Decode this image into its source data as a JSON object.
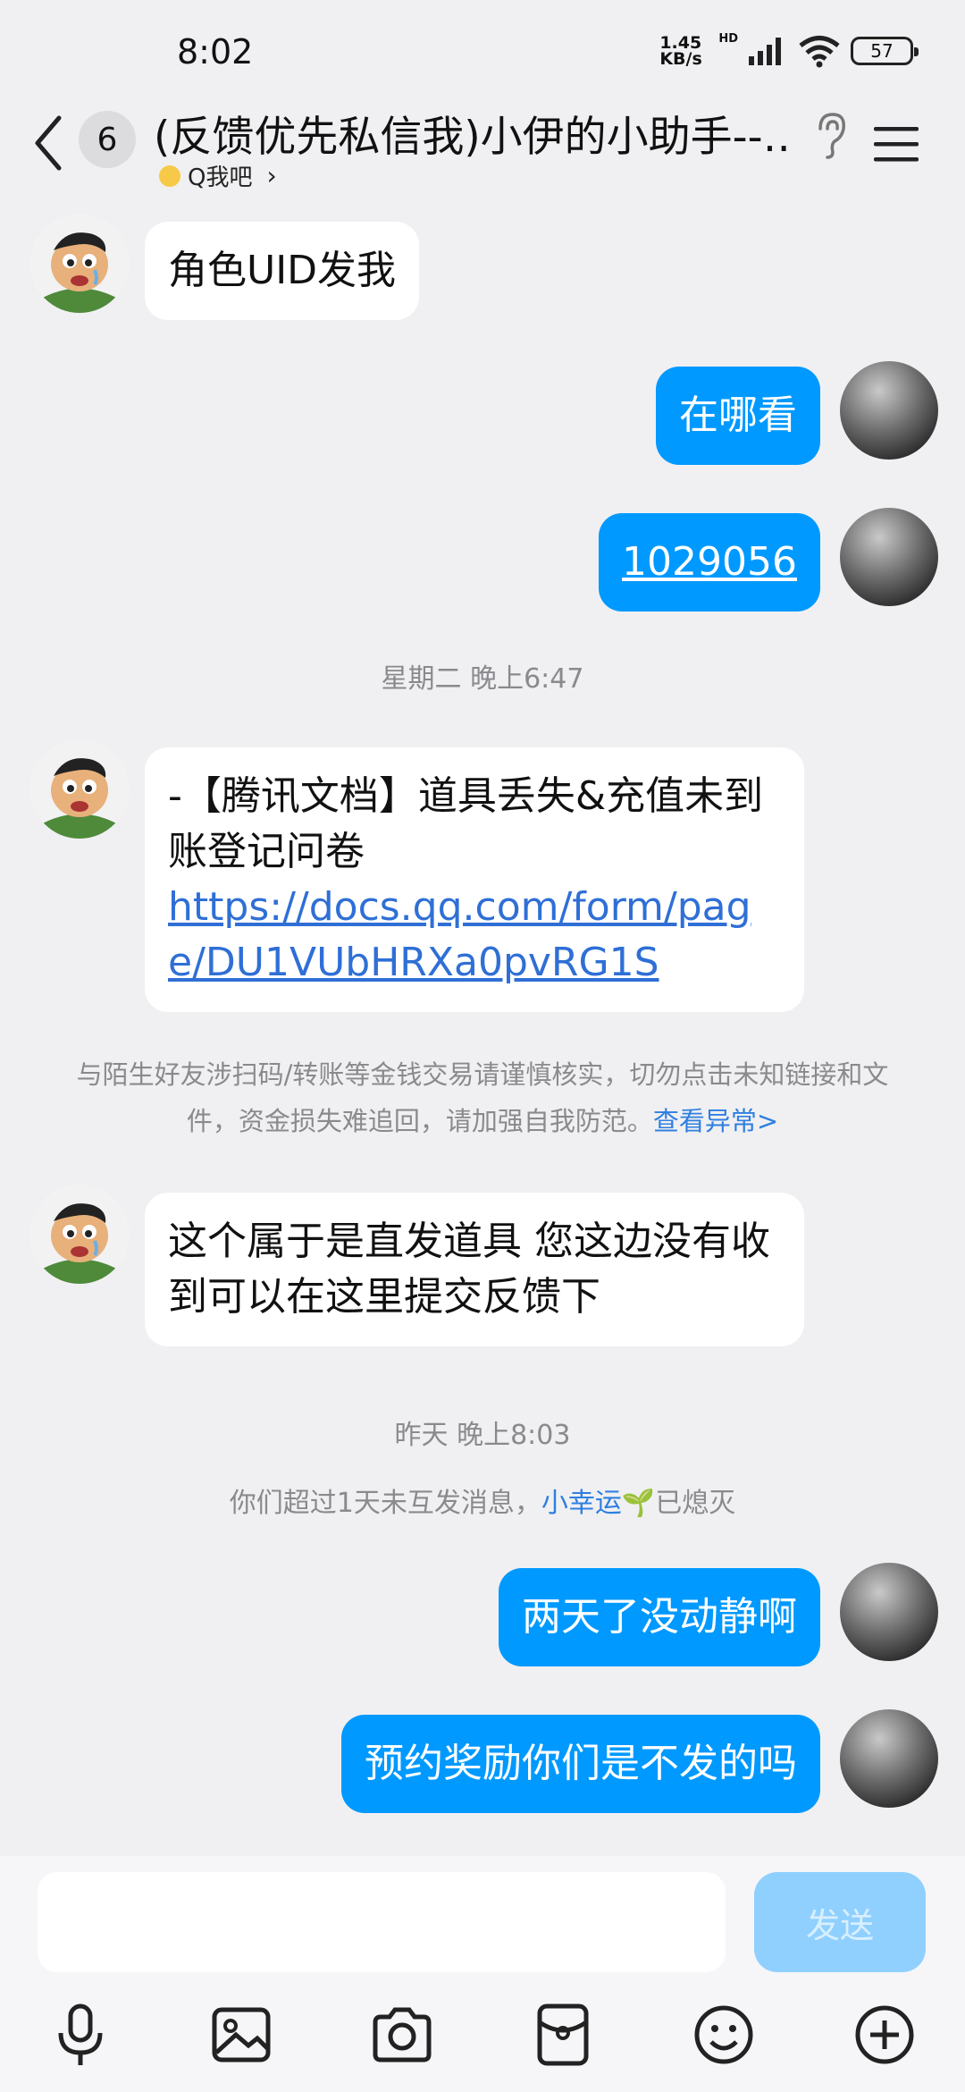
{
  "status_bar": {
    "time": "8:02",
    "net_speed_value": "1.45",
    "net_speed_unit": "KB/s",
    "network_label": "HD",
    "battery": "57"
  },
  "header": {
    "unread_count": "6",
    "title": "(反馈优先私信我)小伊的小助手--…",
    "subtitle": "Q我吧"
  },
  "messages": {
    "m1": "角色UID发我",
    "m2": "在哪看",
    "m3": "1029056",
    "time1": "星期二 晚上6:47",
    "m4_text": "-【腾讯文档】道具丢失&充值未到账登记问卷",
    "m4_link": "https://docs.qq.com/form/page/DU1VUbHRXa0pvRG1S",
    "warning_text": "与陌生好友涉扫码/转账等金钱交易请谨慎核实，切勿点击未知链接和文件，资金损失难追回，请加强自我防范。",
    "warning_link": "查看异常>",
    "m5": "这个属于是直发道具  您这边没有收到可以在这里提交反馈下",
    "time2": "昨天 晚上8:03",
    "spark_prefix": "你们超过1天未互发消息，",
    "spark_name": "小幸运",
    "spark_suffix": "已熄灭",
    "m6": "两天了没动静啊",
    "m7": "预约奖励你们是不发的吗"
  },
  "input": {
    "placeholder": "",
    "send_label": "发送"
  },
  "toolbar": {
    "icons": [
      "microphone-icon",
      "image-icon",
      "camera-icon",
      "red-packet-icon",
      "emoji-icon",
      "plus-icon"
    ]
  },
  "colors": {
    "accent": "#0099ff",
    "send_disabled": "#8fd0ff",
    "background": "#f0f0f2",
    "link": "#2f7fe0"
  }
}
